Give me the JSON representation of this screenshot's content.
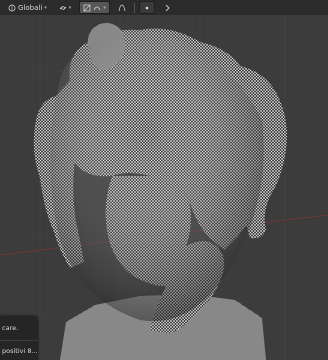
{
  "toolbar": {
    "transform_orientation": "Globali",
    "pivot_icon": "link-icon",
    "snap_icon": "snap-icon",
    "proportional_icon": "proportional-edit-icon",
    "falloff_icon": "falloff-curve-icon",
    "options_icon": "dot-icon"
  },
  "popup": {
    "line1": "care.",
    "line2": "positivi 8..."
  },
  "colors": {
    "background": "#3c3c3c",
    "grid": "#4a4a4a",
    "wireframe": "#f2f2f2",
    "mesh_shadow": "#1e1e1e",
    "axis_red": "#8a3a3a"
  }
}
